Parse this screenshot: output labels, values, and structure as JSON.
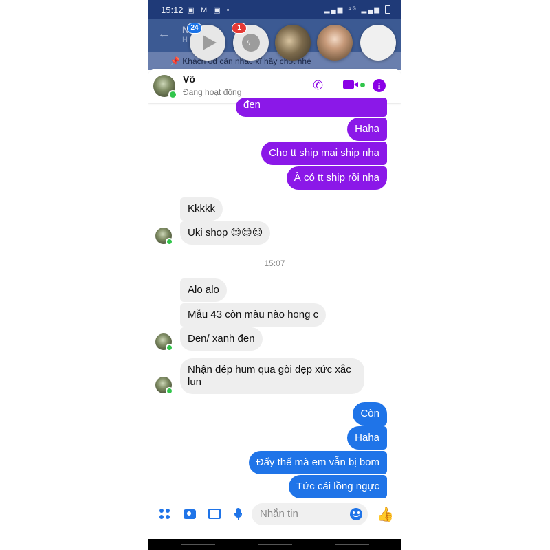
{
  "status_bar": {
    "time": "15:12",
    "icons": "▣ M ▣ •",
    "network": "⁴ᴳ"
  },
  "underlay": {
    "title": "N",
    "subtitle": "H",
    "banner": "📌 Khách od cân nhắc kĩ hãy chốt nhé"
  },
  "chat_heads": [
    {
      "badge": "24",
      "icon": "play-icon"
    },
    {
      "badge": "1",
      "icon": "messenger-icon"
    },
    {
      "icon": "contact-photo"
    },
    {
      "icon": "contact-photo"
    },
    {
      "icon": "empty-chat-head"
    }
  ],
  "chat_header": {
    "name": "Võ",
    "status": "Đang hoạt động",
    "icons": [
      "phone-icon",
      "video-call-icon",
      "info-icon"
    ],
    "accent": "#8b18e8"
  },
  "messages": {
    "out_1": "đen",
    "out_2": "Haha",
    "out_3": "Cho tt ship mai ship nha",
    "out_4": "À có tt ship rồi nha",
    "in_1": "Kkkkk",
    "in_2": "Uki shop 😊😊😊",
    "timestamp": "15:07",
    "in_3": "Alo alo",
    "in_4": "Mẫu 43 còn màu nào hong c",
    "in_5": "Đen/ xanh đen",
    "in_6_line1": "Nhận dép hum qua gòi đẹp xức xắc",
    "in_6_line2": "lun",
    "out_5": "Còn",
    "out_6": "Haha",
    "out_7": "Đấy thế mà em vẫn bị bom",
    "out_8": "Tức cái lồng ngực"
  },
  "colors": {
    "purple_bubble": "#8b18e8",
    "blue_bubble": "#1f74e8",
    "incoming_bubble": "#eeeeee"
  },
  "composer": {
    "placeholder": "Nhắn tin",
    "icons": [
      "apps-icon",
      "camera-icon",
      "gallery-icon",
      "mic-icon",
      "emoji-icon",
      "like-icon"
    ]
  }
}
